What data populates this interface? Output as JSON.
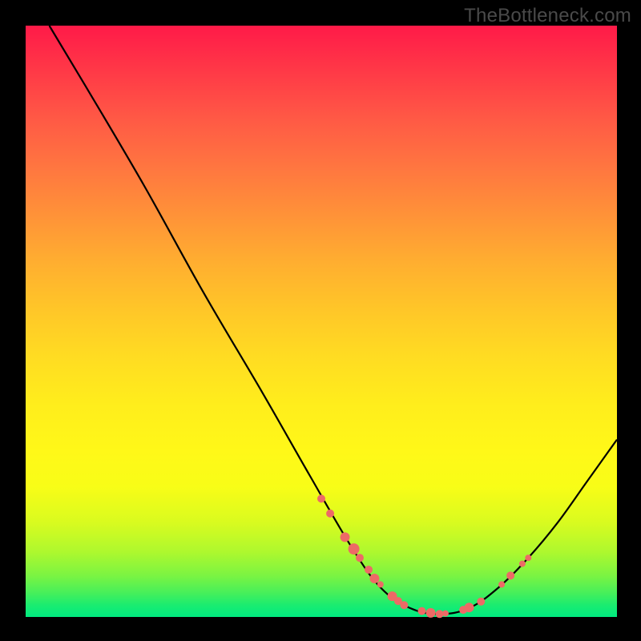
{
  "watermark": "TheBottleneck.com",
  "chart_data": {
    "type": "line",
    "title": "",
    "xlabel": "",
    "ylabel": "",
    "xlim": [
      0,
      100
    ],
    "ylim": [
      0,
      100
    ],
    "curve": [
      {
        "x": 4,
        "y": 100
      },
      {
        "x": 10,
        "y": 90
      },
      {
        "x": 20,
        "y": 73
      },
      {
        "x": 30,
        "y": 55
      },
      {
        "x": 40,
        "y": 38
      },
      {
        "x": 48,
        "y": 24
      },
      {
        "x": 55,
        "y": 12
      },
      {
        "x": 60,
        "y": 5
      },
      {
        "x": 65,
        "y": 1.5
      },
      {
        "x": 70,
        "y": 0.5
      },
      {
        "x": 75,
        "y": 1.5
      },
      {
        "x": 80,
        "y": 5
      },
      {
        "x": 85,
        "y": 10
      },
      {
        "x": 90,
        "y": 16
      },
      {
        "x": 95,
        "y": 23
      },
      {
        "x": 100,
        "y": 30
      }
    ],
    "markers": [
      {
        "x": 50,
        "y": 20,
        "r": 5
      },
      {
        "x": 51.5,
        "y": 17.5,
        "r": 5
      },
      {
        "x": 54,
        "y": 13.5,
        "r": 6
      },
      {
        "x": 55.5,
        "y": 11.5,
        "r": 7
      },
      {
        "x": 56.5,
        "y": 10,
        "r": 5
      },
      {
        "x": 58,
        "y": 8,
        "r": 5
      },
      {
        "x": 59,
        "y": 6.5,
        "r": 6
      },
      {
        "x": 60,
        "y": 5.5,
        "r": 4
      },
      {
        "x": 62,
        "y": 3.5,
        "r": 6
      },
      {
        "x": 63,
        "y": 2.7,
        "r": 5
      },
      {
        "x": 64,
        "y": 2,
        "r": 5
      },
      {
        "x": 67,
        "y": 1,
        "r": 5
      },
      {
        "x": 68.5,
        "y": 0.7,
        "r": 6
      },
      {
        "x": 70,
        "y": 0.5,
        "r": 5
      },
      {
        "x": 71,
        "y": 0.6,
        "r": 4
      },
      {
        "x": 74,
        "y": 1.2,
        "r": 5
      },
      {
        "x": 75,
        "y": 1.6,
        "r": 6
      },
      {
        "x": 77,
        "y": 2.6,
        "r": 5
      },
      {
        "x": 80.5,
        "y": 5.5,
        "r": 4
      },
      {
        "x": 82,
        "y": 7,
        "r": 5
      },
      {
        "x": 84,
        "y": 9,
        "r": 4
      },
      {
        "x": 85,
        "y": 10,
        "r": 4
      }
    ],
    "marker_color": "#ed6a66",
    "curve_color": "#000000"
  }
}
